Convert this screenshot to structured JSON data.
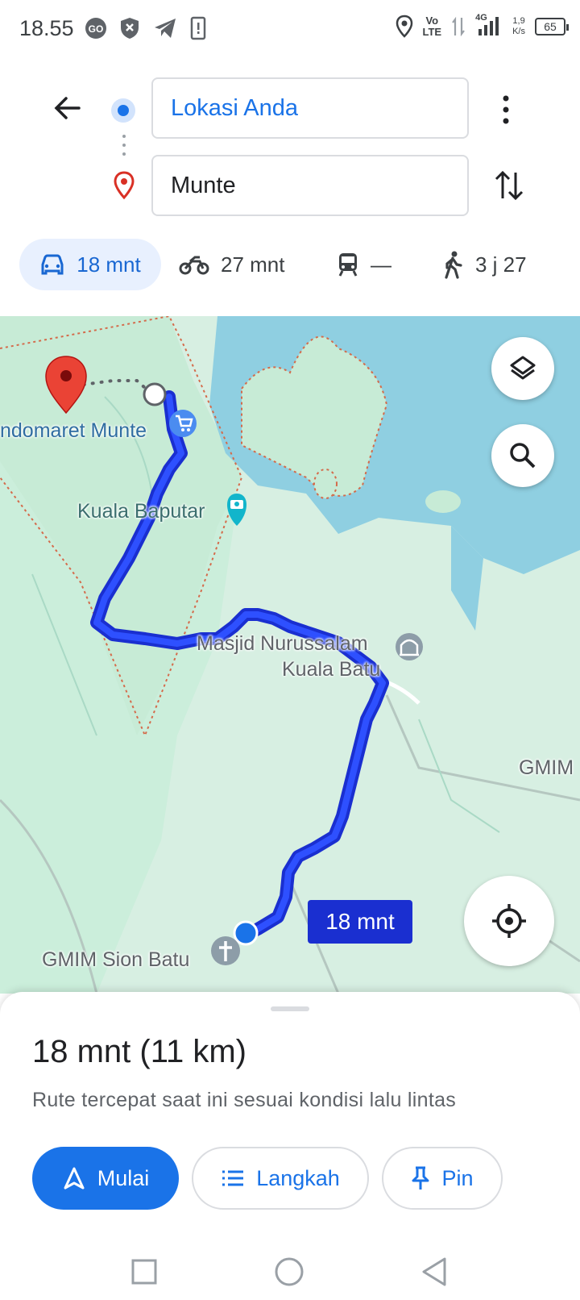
{
  "status": {
    "time": "18.55",
    "net_speed_top": "1,9",
    "net_speed_bottom": "K/s",
    "battery": "65",
    "network": "4G",
    "volte": "Vo",
    "volte2": "LTE"
  },
  "route": {
    "origin": "Lokasi Anda",
    "destination": "Munte"
  },
  "modes": [
    {
      "name": "car",
      "label": "18 mnt"
    },
    {
      "name": "motorcycle",
      "label": "27 mnt"
    },
    {
      "name": "transit",
      "label": "—"
    },
    {
      "name": "walk",
      "label": "3 j 27"
    }
  ],
  "map": {
    "labels": [
      "ndomaret Munte",
      "Kuala Baputar",
      "Masjid Nurussalam",
      "Kuala Batu",
      "GMIM",
      "GMIM Sion Batu"
    ],
    "route_time": "18 mnt"
  },
  "sheet": {
    "summary": "18 mnt (11 km)",
    "description": "Rute tercepat saat ini sesuai kondisi lalu lintas",
    "start": "Mulai",
    "steps": "Langkah",
    "pin": "Pin"
  },
  "colors": {
    "accent": "#1a73e8",
    "route": "#1a2fd0",
    "water": "#90d0e0",
    "land": "#d7efe2"
  }
}
